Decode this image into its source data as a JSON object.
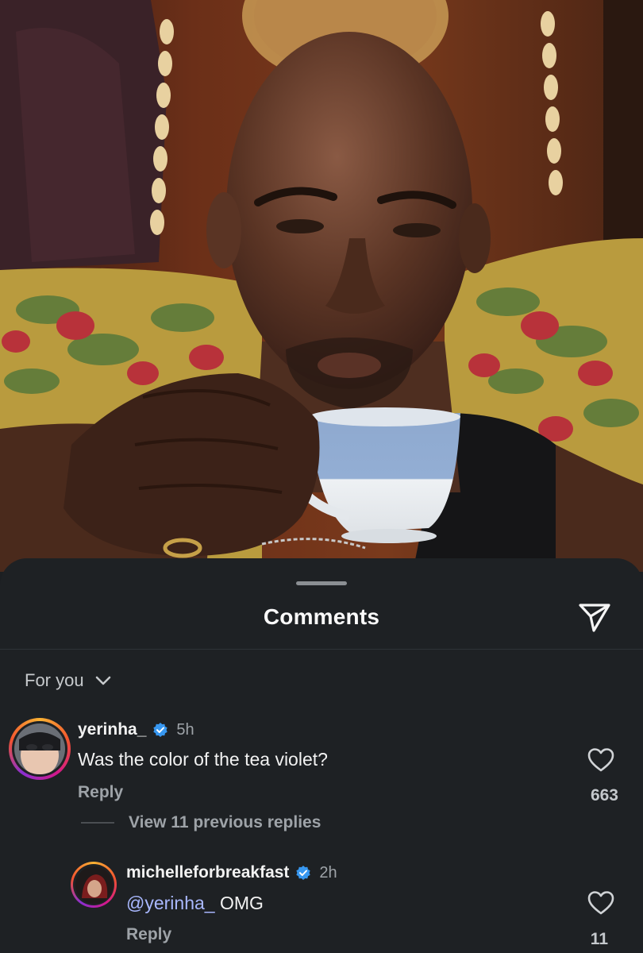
{
  "sheet": {
    "title": "Comments",
    "sort_label": "For you"
  },
  "comments": [
    {
      "username": "yerinha_",
      "verified": true,
      "time": "5h",
      "text": "Was the color of the tea violet?",
      "reply_label": "Reply",
      "likes": "663",
      "view_replies": "View 11 previous replies"
    },
    {
      "username": "michelleforbreakfast",
      "verified": true,
      "time": "2h",
      "mention": "@yerinha_",
      "text": " OMG",
      "reply_label": "Reply",
      "likes": "11"
    }
  ],
  "colors": {
    "sheet_bg": "#1e2124",
    "verified": "#3797f0",
    "mention": "#a9b8ff",
    "muted": "#9ea3a8"
  },
  "icons": [
    "share-icon",
    "chevron-down-icon",
    "verified-badge-icon",
    "heart-icon"
  ]
}
